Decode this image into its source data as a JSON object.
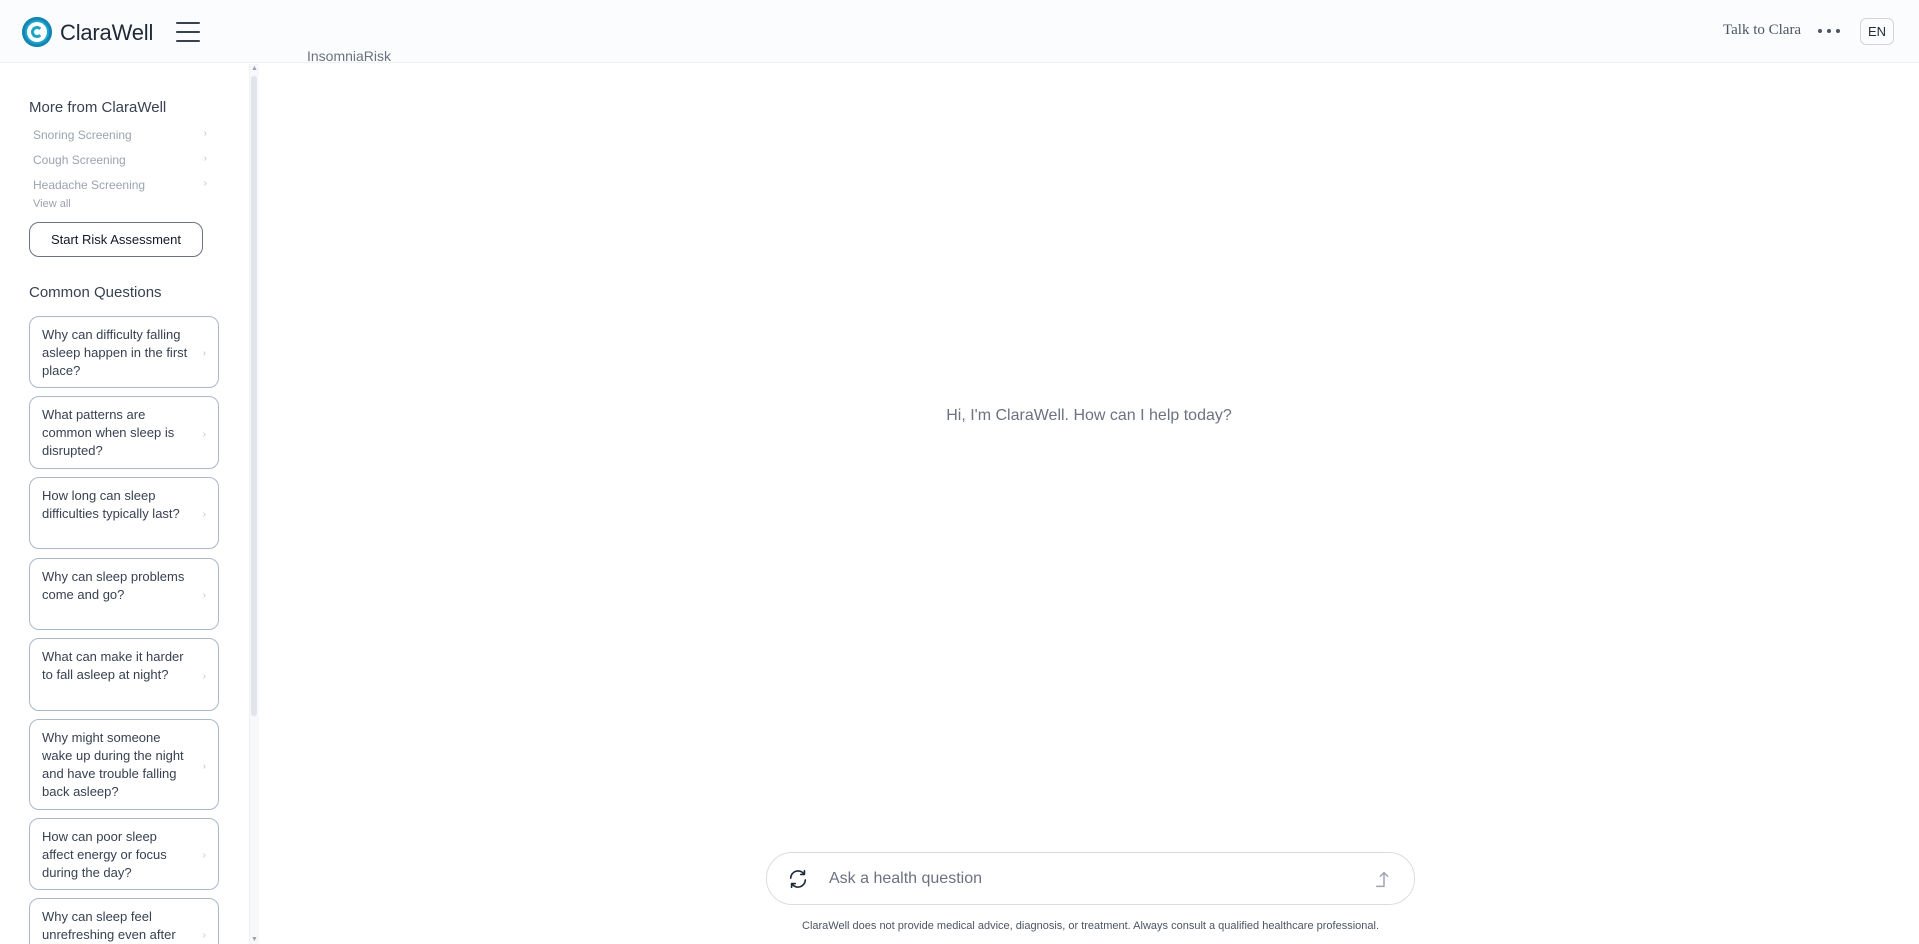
{
  "header": {
    "brand": "ClaraWell",
    "breadcrumb": "InsomniaRisk",
    "talk_link": "Talk to Clara",
    "language": "EN"
  },
  "sidebar": {
    "more_title": "More from ClaraWell",
    "screenings": [
      {
        "label": "Snoring Screening"
      },
      {
        "label": "Cough Screening"
      },
      {
        "label": "Headache Screening"
      }
    ],
    "view_all": "View all",
    "start_button": "Start Risk Assessment",
    "questions_title": "Common Questions",
    "questions": [
      {
        "label": "Why can difficulty falling asleep happen in the first place?"
      },
      {
        "label": "What patterns are common when sleep is disrupted?"
      },
      {
        "label": "How long can sleep difficulties typically last?"
      },
      {
        "label": "Why can sleep problems come and go?"
      },
      {
        "label": "What can make it harder to fall asleep at night?"
      },
      {
        "label": "Why might someone wake up during the night and have trouble falling back asleep?"
      },
      {
        "label": "How can poor sleep affect energy or focus during the day?"
      },
      {
        "label": "Why can sleep feel unrefreshing even after"
      }
    ]
  },
  "main": {
    "greeting": "Hi, I'm ClaraWell. How can I help today?",
    "input_placeholder": "Ask a health question",
    "disclaimer": "ClaraWell does not provide medical advice, diagnosis, or treatment. Always consult a qualified healthcare professional."
  },
  "colors": {
    "brand": "#1aa6c9",
    "card_border": "#a9b8cb",
    "muted_text": "#6b7280"
  }
}
